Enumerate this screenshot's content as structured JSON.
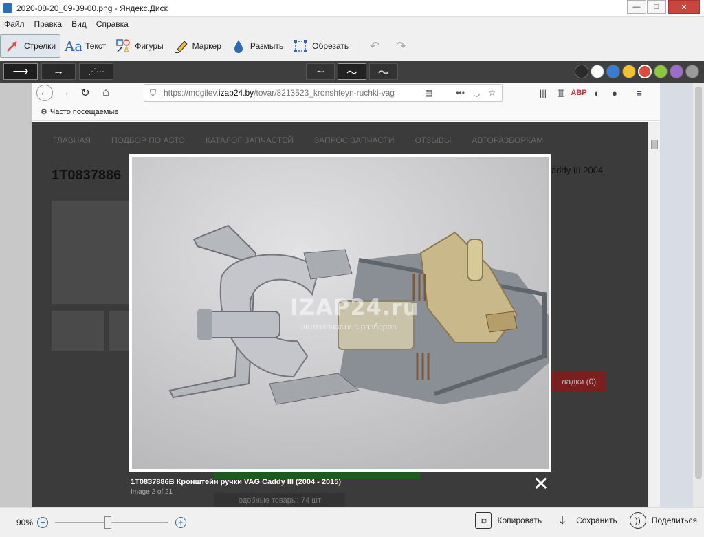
{
  "window": {
    "title": "2020-08-20_09-39-00.png - Яндекс.Диск",
    "minimize": "—",
    "maximize": "□",
    "close": "✕"
  },
  "menu": [
    "Файл",
    "Правка",
    "Вид",
    "Справка"
  ],
  "tools": {
    "arrows": "Стрелки",
    "text": "Текст",
    "shapes": "Фигуры",
    "marker": "Маркер",
    "blur": "Размыть",
    "crop": "Обрезать"
  },
  "colors": [
    "#2b2b2b",
    "#ffffff",
    "#3a7bd5",
    "#f2c12e",
    "#e04a3c",
    "#8dc63f",
    "#9b6dc6",
    "#9a9a9a"
  ],
  "browser": {
    "url_prefix": "https://mogilev.",
    "url_domain": "izap24.by",
    "url_rest": "/tovar/8213523_kronshteyn-ruchki-vag",
    "bookmark": "Часто посещаемые"
  },
  "site": {
    "nav": [
      "ГЛАВНАЯ",
      "ПОДБОР ПО АВТО",
      "КАТАЛОГ ЗАПЧАСТЕЙ",
      "ЗАПРОС ЗАПЧАСТИ",
      "ОТЗЫВЫ",
      "АВТОРАЗБОРКАМ"
    ],
    "heading_partial": "1T0837886",
    "right_partial": "addy III 2004",
    "cart_partial": "ладки (0)",
    "btn_partial": "одобные товары: 74 шт"
  },
  "lightbox": {
    "watermark_logo": "IZAP24.ru",
    "watermark_tagline": "автозапчасти с разборов",
    "caption": "1T0837886B Кронштейн ручки VAG Caddy III (2004 - 2015)",
    "counter": "Image 2 of 21",
    "close": "✕"
  },
  "status": {
    "zoom": "90%",
    "zoom_level": 0.45,
    "copy": "Копировать",
    "save": "Сохранить",
    "share": "Поделиться"
  }
}
